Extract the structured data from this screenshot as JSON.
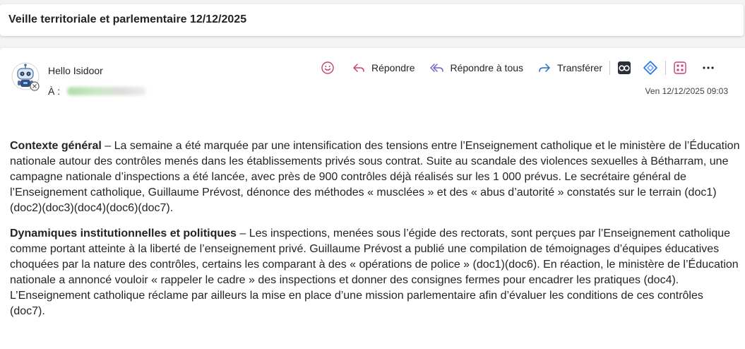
{
  "subject": "Veille territoriale et parlementaire 12/12/2025",
  "message": {
    "sender": "Hello Isidoor",
    "to_label": "À :",
    "timestamp": "Ven 12/12/2025 09:03"
  },
  "toolbar": {
    "emoji_icon": "smiley-icon",
    "reply_label": "Répondre",
    "reply_all_label": "Répondre à tous",
    "forward_label": "Transférer",
    "addin_icons": [
      "glasses-icon",
      "diamond-link-icon",
      "grid-app-icon"
    ],
    "more_icon": "more-horizontal-icon"
  },
  "colors": {
    "accent": "#5b5fc7",
    "emoji_pink": "#c5407a",
    "reply_blue": "#1f6fc8",
    "link_blue": "#2b6fd8"
  },
  "body": {
    "p1_heading": "Contexte général",
    "p1_text": " – La semaine a été marquée par une intensification des tensions entre l’Enseignement catholique et le ministère de l’Éducation nationale autour des contrôles menés dans les établissements privés sous contrat. Suite au scandale des violences sexuelles à Bétharram, une campagne nationale d’inspections a été lancée, avec près de 900 contrôles déjà réalisés sur les 1 000 prévus. Le secrétaire général de l’Enseignement catholique, Guillaume Prévost, dénonce des méthodes « musclées » et des « abus d’autorité » constatés sur le terrain (doc1)(doc2)(doc3)(doc4)(doc6)(doc7).",
    "p2_heading": "Dynamiques institutionnelles et politiques",
    "p2_text": " – Les inspections, menées sous l’égide des rectorats, sont perçues par l’Enseignement catholique comme portant atteinte à la liberté de l’enseignement privé. Guillaume Prévost a publié une compilation de témoignages d’équipes éducatives choquées par la nature des contrôles, certains les comparant à des « opérations de police » (doc1)(doc6). En réaction, le ministère de l’Éducation nationale a annoncé vouloir « rappeler le cadre » des inspections et donner des consignes fermes pour encadrer les pratiques (doc4). L’Enseignement catholique réclame par ailleurs la mise en place d’une mission parlementaire afin d’évaluer les conditions de ces contrôles (doc7)."
  }
}
